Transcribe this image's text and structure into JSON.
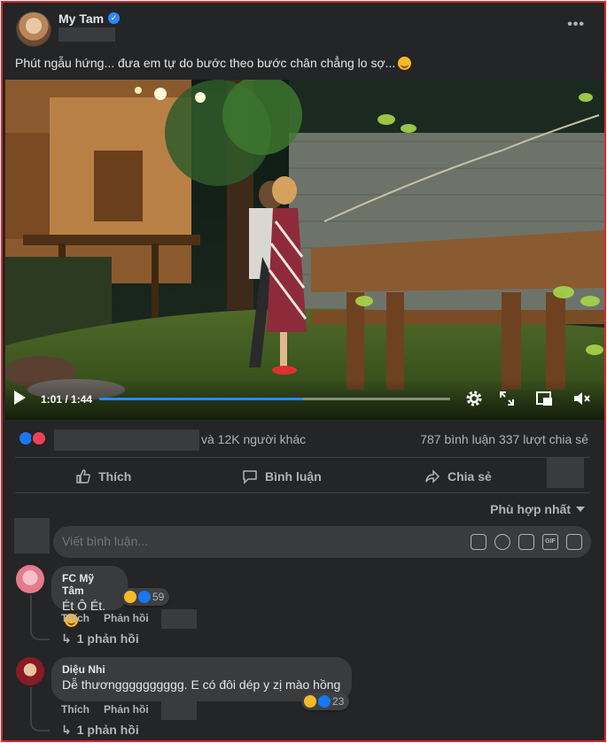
{
  "post": {
    "author": "My Tam",
    "caption": "Phút ngẫu hứng... đưa em tự do bước theo bước chân chẳng lo sợ...",
    "more_label": "•••"
  },
  "video": {
    "time": "1:01 / 1:44",
    "progress": 0.58
  },
  "summary": {
    "others": "và 12K người khác",
    "counts": "787 bình luận  337 lượt chia sẻ"
  },
  "actions": {
    "like": "Thích",
    "comment": "Bình luận",
    "share": "Chia sẻ"
  },
  "sort_label": "Phù hợp nhất",
  "comment_box": {
    "placeholder": "Viết bình luận..."
  },
  "comments": [
    {
      "name": "FC Mỹ Tâm",
      "text": "Ét Ô Ét.",
      "reaction_count": "59",
      "like": "Thích",
      "reply": "Phản hồi",
      "replies": "1 phản hồi"
    },
    {
      "name": "Diệu Nhi",
      "text": "Dễ thươngggggggggg. E có đôi dép y zị mào hồng",
      "reaction_count": "23",
      "like": "Thích",
      "reply": "Phản hồi",
      "replies": "1 phản hồi"
    }
  ],
  "colors": {
    "background": "#242526",
    "accent": "#2d88ff",
    "border": "#e0262a"
  }
}
